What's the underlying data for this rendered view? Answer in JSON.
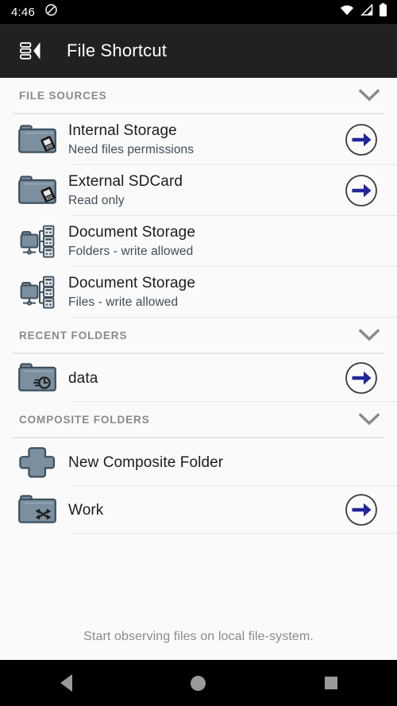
{
  "statusbar": {
    "time": "4:46",
    "icons": [
      "do-not-disturb-icon",
      "wifi-icon",
      "cellular-signal-icon",
      "battery-icon"
    ]
  },
  "appbar": {
    "menu_icon": "drawer-open-icon",
    "title": "File Shortcut"
  },
  "colors": {
    "appbar_bg": "#212121",
    "page_bg": "#fafafa",
    "folder_fill": "#7b8f9e",
    "folder_stroke": "#3d4f5c",
    "arrow_blue": "#23259b",
    "section_label": "#8a8a8a",
    "subtitle": "#3f4e5a",
    "footer": "#8b8b8b"
  },
  "sections": [
    {
      "label": "FILE SOURCES",
      "collapse_icon": "chevron-down-icon",
      "items": [
        {
          "icon": "folder-device-icon",
          "title": "Internal Storage",
          "subtitle": "Need files permissions",
          "action": "arrow-right-circle-icon"
        },
        {
          "icon": "folder-device-icon",
          "title": "External SDCard",
          "subtitle": "Read only",
          "action": "arrow-right-circle-icon"
        },
        {
          "icon": "folder-network-icon",
          "title": "Document Storage",
          "subtitle": "Folders - write allowed",
          "action": null
        },
        {
          "icon": "folder-network-icon",
          "title": "Document Storage",
          "subtitle": "Files - write allowed",
          "action": null
        }
      ]
    },
    {
      "label": "RECENT FOLDERS",
      "collapse_icon": "chevron-down-icon",
      "items": [
        {
          "icon": "folder-clock-icon",
          "title": "data",
          "subtitle": null,
          "action": "arrow-right-circle-icon"
        }
      ]
    },
    {
      "label": "COMPOSITE FOLDERS",
      "collapse_icon": "chevron-down-icon",
      "items": [
        {
          "icon": "plus-icon",
          "title": "New Composite Folder",
          "subtitle": null,
          "action": null
        },
        {
          "icon": "folder-shuffle-icon",
          "title": "Work",
          "subtitle": null,
          "action": "arrow-right-circle-icon"
        }
      ]
    }
  ],
  "footer": {
    "note": "Start observing files on local file-system."
  },
  "navbar": {
    "back": "back-triangle-icon",
    "home": "home-circle-icon",
    "recents": "recents-square-icon"
  }
}
